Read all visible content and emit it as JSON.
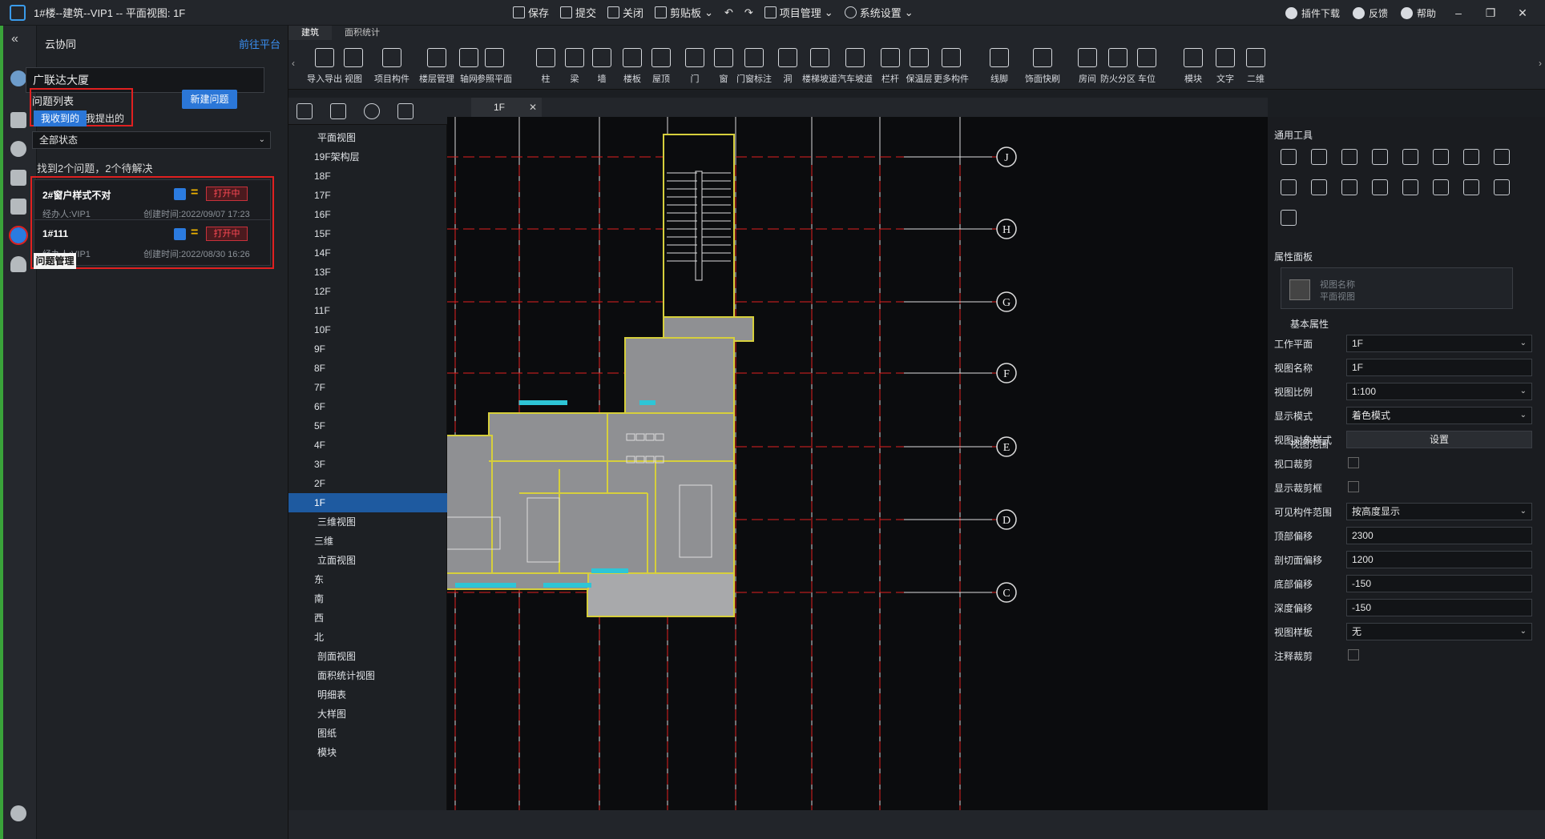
{
  "titlebar": {
    "title": "1#楼--建筑--VIP1 -- 平面视图: 1F",
    "actions": [
      "保存",
      "提交",
      "关闭",
      "剪贴板",
      "项目管理",
      "系统设置"
    ],
    "right_items": [
      "插件下载",
      "反馈",
      "帮助"
    ]
  },
  "panel": {
    "header_title": "云协同",
    "header_link": "前往平台",
    "project_name": "广联达大厦",
    "issue_list_title": "问题列表",
    "tab_received": "我收到的",
    "tab_submitted": "我提出的",
    "new_issue_button": "新建问题",
    "status_filter": "全部状态",
    "found_text": "找到2个问题，2个待解决",
    "tooltip": "问题管理",
    "issues": [
      {
        "name": "2#窗户样式不对",
        "status": "打开中",
        "assignee": "经办人:VIP1",
        "created": "创建时间:2022/09/07 17:23"
      },
      {
        "name": "1#111",
        "status": "打开中",
        "assignee": "经办人:VIP1",
        "created": "创建时间:2022/08/30 16:26"
      }
    ]
  },
  "ribbon": {
    "tabs": [
      "建筑",
      "面积统计"
    ],
    "tools": [
      "导入导出",
      "视图",
      "项目构件",
      "楼层管理",
      "轴网",
      "参照平面",
      "柱",
      "梁",
      "墙",
      "楼板",
      "屋顶",
      "门",
      "窗",
      "门窗标注",
      "洞",
      "楼梯坡道",
      "汽车坡道",
      "栏杆",
      "保温层",
      "更多构件",
      "线脚",
      "饰面快刷",
      "房间",
      "防火分区",
      "车位",
      "模块",
      "文字",
      "二维"
    ]
  },
  "tree": {
    "items": [
      "平面视图",
      "19F架构层",
      "18F",
      "17F",
      "16F",
      "15F",
      "14F",
      "13F",
      "12F",
      "11F",
      "10F",
      "9F",
      "8F",
      "7F",
      "6F",
      "5F",
      "4F",
      "3F",
      "2F",
      "1F",
      "三维视图",
      "三维",
      "立面视图",
      "东",
      "南",
      "西",
      "北",
      "剖面视图",
      "面积统计视图",
      "明细表",
      "大样图",
      "图纸",
      "模块"
    ],
    "selected": "1F"
  },
  "view_tab": "1F",
  "axes": [
    "J",
    "H",
    "G",
    "F",
    "E",
    "D",
    "C"
  ],
  "right_panel": {
    "general_tools": "通用工具",
    "properties_panel": "属性面板",
    "view_name_placeholder_1": "视图名称",
    "view_name_placeholder_2": "平面视图",
    "basic_props": "基本属性",
    "view_range": "视图范围",
    "props": [
      {
        "label": "工作平面",
        "value": "1F",
        "kind": "select"
      },
      {
        "label": "视图名称",
        "value": "1F",
        "kind": "input"
      },
      {
        "label": "视图比例",
        "value": "1:100",
        "kind": "select"
      },
      {
        "label": "显示模式",
        "value": "着色模式",
        "kind": "select"
      },
      {
        "label": "视图对象样式",
        "value": "设置",
        "kind": "button"
      }
    ],
    "range_props": [
      {
        "label": "视口裁剪",
        "value": "",
        "kind": "checkbox"
      },
      {
        "label": "显示裁剪框",
        "value": "",
        "kind": "checkbox"
      },
      {
        "label": "可见构件范围",
        "value": "按高度显示",
        "kind": "select"
      },
      {
        "label": "顶部偏移",
        "value": "2300",
        "kind": "input"
      },
      {
        "label": "剖切面偏移",
        "value": "1200",
        "kind": "input"
      },
      {
        "label": "底部偏移",
        "value": "-150",
        "kind": "input"
      },
      {
        "label": "深度偏移",
        "value": "-150",
        "kind": "input"
      },
      {
        "label": "视图样板",
        "value": "无",
        "kind": "select"
      },
      {
        "label": "注释裁剪",
        "value": "",
        "kind": "checkbox"
      }
    ]
  }
}
